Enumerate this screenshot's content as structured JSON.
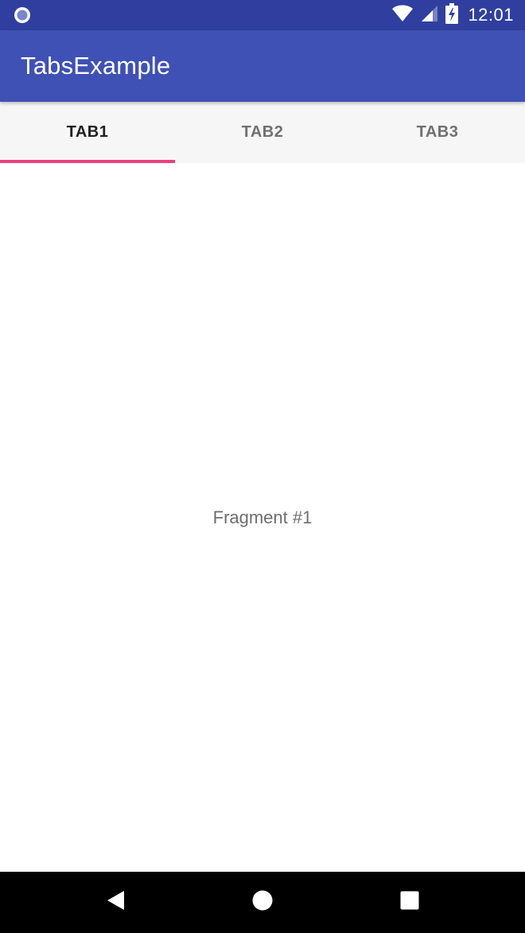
{
  "status_bar": {
    "time": "12:01",
    "left_icon": "notification-circle-icon",
    "icons": [
      "wifi-icon",
      "signal-icon",
      "battery-charging-icon"
    ],
    "background_color": "#303f9f"
  },
  "app_bar": {
    "title": "TabsExample",
    "background_color": "#3f51b5"
  },
  "tabs": {
    "items": [
      {
        "label": "TAB1",
        "selected": true
      },
      {
        "label": "TAB2",
        "selected": false
      },
      {
        "label": "TAB3",
        "selected": false
      }
    ],
    "indicator_color": "#ec407a"
  },
  "content": {
    "fragment_text": "Fragment #1"
  },
  "nav_bar": {
    "buttons": [
      "back-icon",
      "home-icon",
      "recents-icon"
    ]
  }
}
